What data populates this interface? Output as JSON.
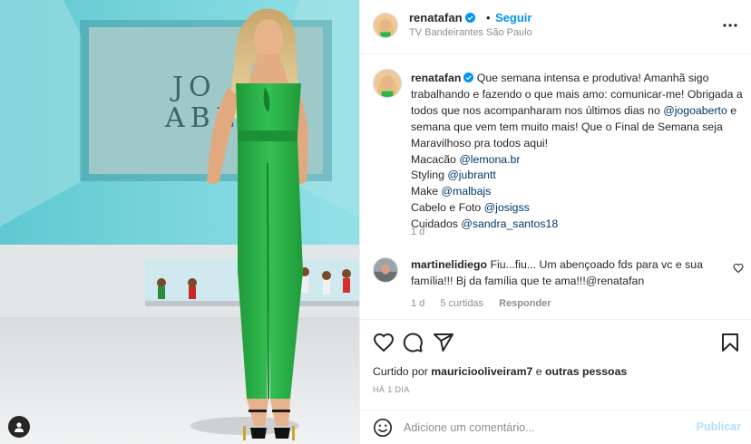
{
  "post": {
    "username": "renatafan",
    "follow_label": "Seguir",
    "separator": "•",
    "location": "TV Bandeirantes São Paulo",
    "icons": {
      "verified": "verified-badge-icon",
      "more": "more-options-icon",
      "tag": "user-tag-icon"
    },
    "colors": {
      "accent": "#0095f6",
      "outfit_green": "#2fb24a",
      "studio_teal": "#6fd3dc"
    }
  },
  "photo": {
    "studio_sign": [
      "JO",
      "ABE"
    ]
  },
  "caption": {
    "username": "renatafan",
    "line1_pre": " Que semana intensa e produtiva! Amanhã sigo trabalhando e fazendo o que mais amo: comunicar-me! Obrigada a todos que nos acompanharam nos últimos dias no ",
    "mention_show": "@jogoaberto",
    "line1_post": " e semana que vem tem muito mais! Que o Final de Semana seja Maravilhoso pra todos aqui!",
    "credits": [
      {
        "label": "Macacão ",
        "mention": "@lemona.br"
      },
      {
        "label": "Styling ",
        "mention": "@jubrantt"
      },
      {
        "label": "Make ",
        "mention": "@malbajs"
      },
      {
        "label": "Cabelo e Foto ",
        "mention": "@josigss"
      },
      {
        "label": "Cuidados ",
        "mention": "@sandra_santos18"
      }
    ],
    "time": "1 d"
  },
  "comment": {
    "username": "martinelidiego",
    "text": " Fiu...fiu... Um abençoado fds para vc e sua família!!! Bj da família que te ama!!!@renatafan",
    "time": "1 d",
    "likes": "5 curtidas",
    "reply_label": "Responder"
  },
  "actions": {
    "icons": [
      "heart-icon",
      "comment-icon",
      "share-icon",
      "bookmark-icon"
    ],
    "liked_by_prefix": "Curtido por ",
    "liked_by_user": "mauriciooliveiram7",
    "liked_by_suffix": " e ",
    "liked_by_others": "outras pessoas",
    "time_ago": "HÁ 1 DIA"
  },
  "add_comment": {
    "placeholder": "Adicione um comentário...",
    "publish_label": "Publicar"
  }
}
